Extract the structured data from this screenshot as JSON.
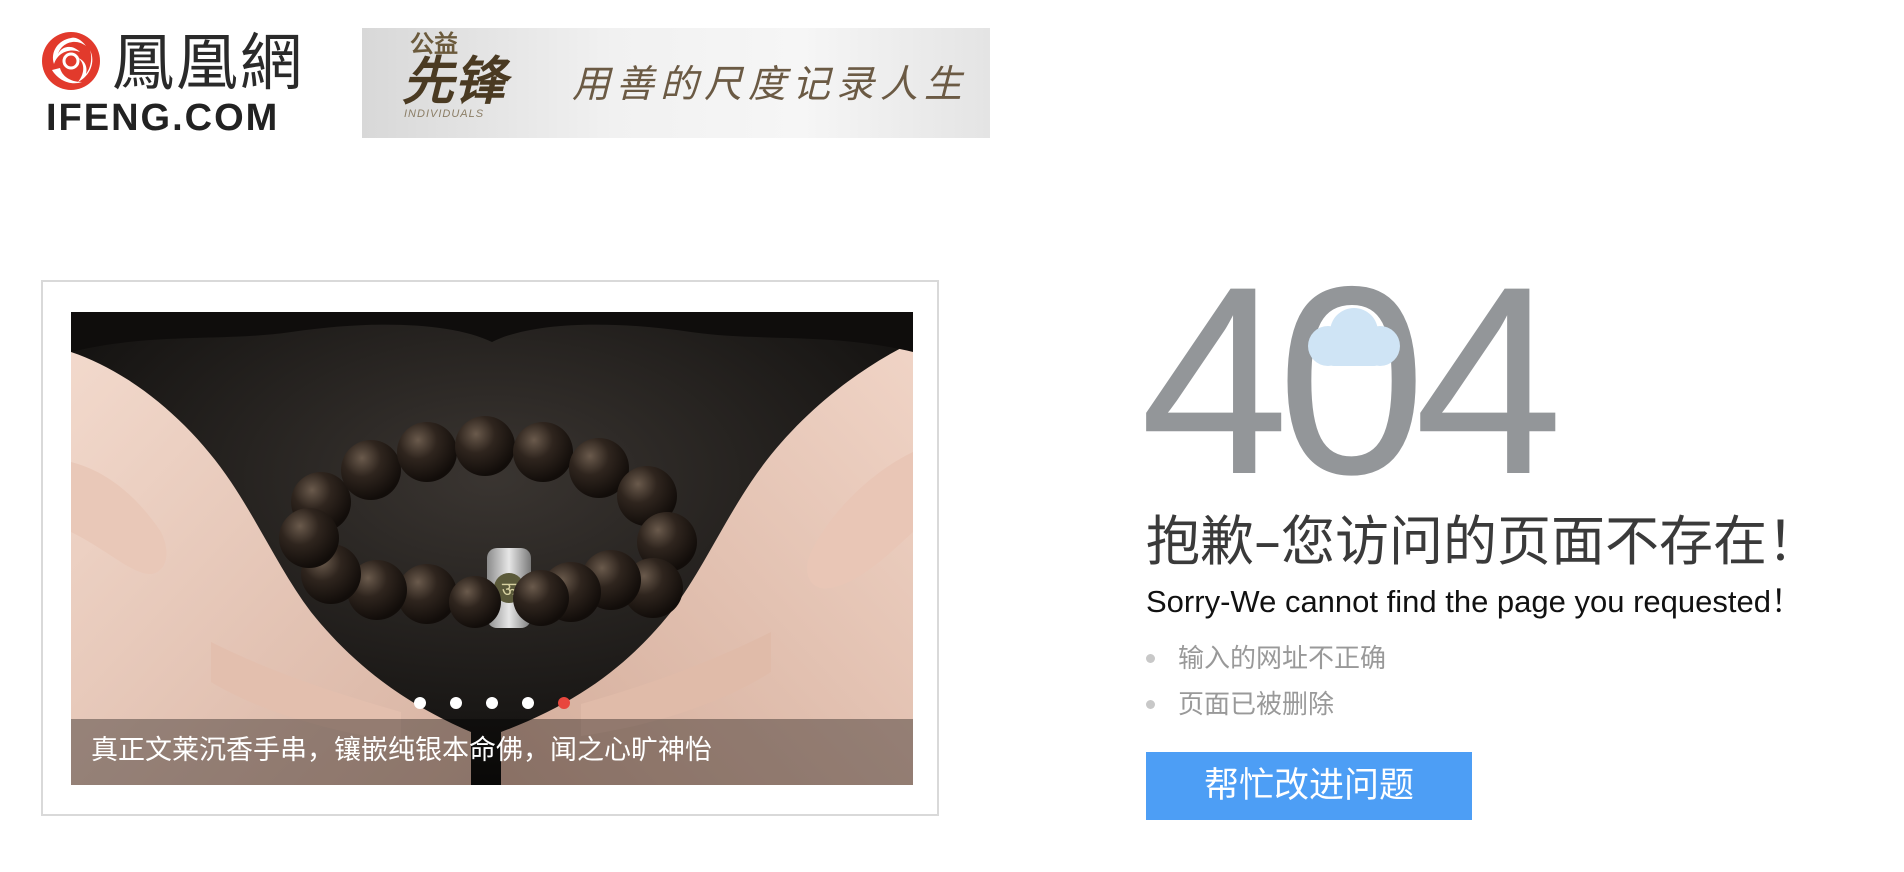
{
  "header": {
    "logo": {
      "name_cn": "鳳凰網",
      "name_en": "IFENG.COM",
      "icon": "ifeng-phoenix-icon"
    },
    "banner": {
      "brand_small": "公益",
      "brand_big": "先锋",
      "brand_en": "INDIVIDUALS",
      "slogan": "用善的尺度记录人生"
    }
  },
  "slideshow": {
    "caption": "真正文莱沉香手串，镶嵌纯银本命佛，闻之心旷神怡",
    "dots": 5,
    "active_dot": 5,
    "image": "agarwood-bracelet-in-hands-photo",
    "colors": {
      "dot": "#ffffff",
      "dot_active": "#e8473e"
    }
  },
  "error": {
    "code": "404",
    "cloud_icon": "cloud-icon",
    "title_cn": "抱歉–您访问的页面不存在！",
    "title_en": "Sorry-We cannot find the page you requested！",
    "reasons": [
      "输入的网址不正确",
      "页面已被删除"
    ],
    "help_button": "帮忙改进问题",
    "colors": {
      "code": "#939699",
      "button": "#4d9ef5",
      "reason_text": "#999999"
    }
  }
}
